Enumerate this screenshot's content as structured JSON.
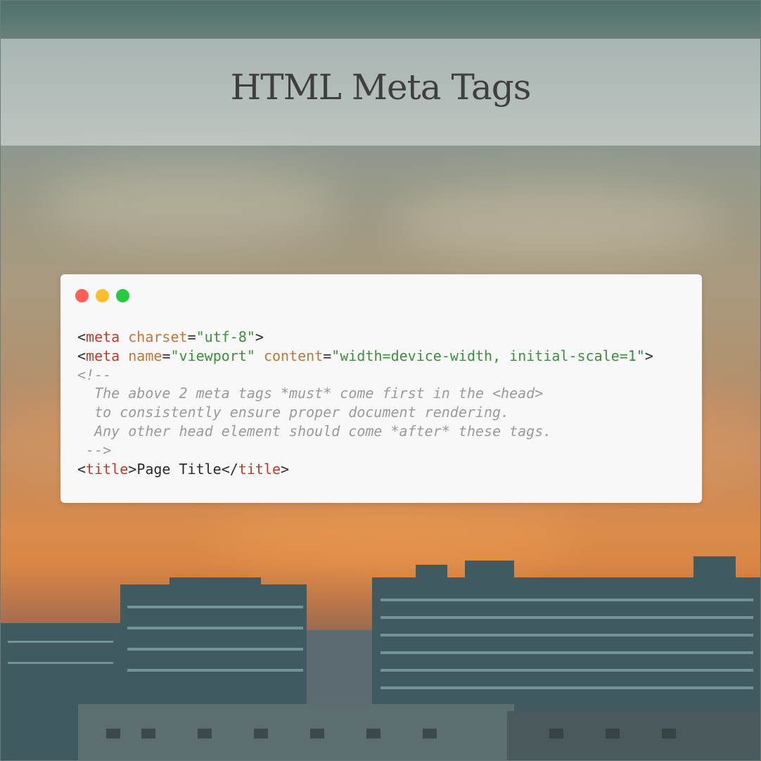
{
  "header": {
    "title": "HTML Meta Tags"
  },
  "code_window": {
    "window_controls": [
      "close",
      "minimize",
      "maximize"
    ],
    "colors": {
      "close": "#ff5f56",
      "minimize": "#ffbd2e",
      "maximize": "#27c93f",
      "tag": "#c0392b",
      "attribute": "#c0763a",
      "string": "#3c8f3c",
      "comment": "#9a9a9a"
    },
    "lines": [
      {
        "tokens": [
          {
            "t": "punct",
            "v": "<"
          },
          {
            "t": "tag",
            "v": "meta"
          },
          {
            "t": "punct",
            "v": " "
          },
          {
            "t": "attr",
            "v": "charset"
          },
          {
            "t": "punct",
            "v": "="
          },
          {
            "t": "str",
            "v": "\"utf-8\""
          },
          {
            "t": "punct",
            "v": ">"
          }
        ]
      },
      {
        "tokens": [
          {
            "t": "punct",
            "v": "<"
          },
          {
            "t": "tag",
            "v": "meta"
          },
          {
            "t": "punct",
            "v": " "
          },
          {
            "t": "attr",
            "v": "name"
          },
          {
            "t": "punct",
            "v": "="
          },
          {
            "t": "str",
            "v": "\"viewport\""
          },
          {
            "t": "punct",
            "v": " "
          },
          {
            "t": "attr",
            "v": "content"
          },
          {
            "t": "punct",
            "v": "="
          },
          {
            "t": "str",
            "v": "\"width=device-width, initial-scale=1\""
          },
          {
            "t": "punct",
            "v": ">"
          }
        ]
      },
      {
        "tokens": [
          {
            "t": "comment",
            "v": "<!--"
          }
        ]
      },
      {
        "tokens": [
          {
            "t": "comment",
            "v": "  The above 2 meta tags *must* come first in the <head>"
          }
        ]
      },
      {
        "tokens": [
          {
            "t": "comment",
            "v": "  to consistently ensure proper document rendering."
          }
        ]
      },
      {
        "tokens": [
          {
            "t": "comment",
            "v": "  Any other head element should come *after* these tags."
          }
        ]
      },
      {
        "tokens": [
          {
            "t": "comment",
            "v": " -->"
          }
        ]
      },
      {
        "tokens": [
          {
            "t": "punct",
            "v": "<"
          },
          {
            "t": "tag",
            "v": "title"
          },
          {
            "t": "punct",
            "v": ">"
          },
          {
            "t": "text",
            "v": "Page Title"
          },
          {
            "t": "punct",
            "v": "</"
          },
          {
            "t": "tag",
            "v": "title"
          },
          {
            "t": "punct",
            "v": ">"
          }
        ]
      }
    ]
  }
}
